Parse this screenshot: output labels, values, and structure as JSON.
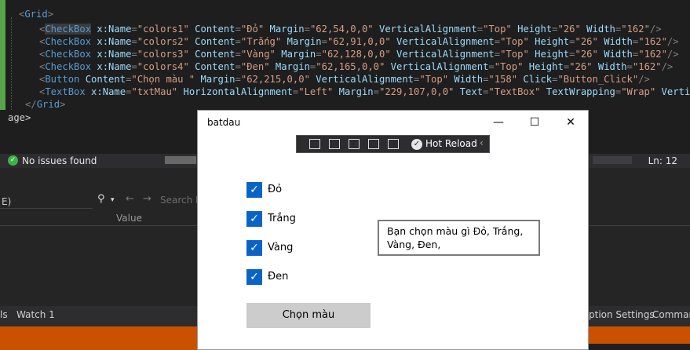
{
  "editor": {
    "lines": [
      [
        {
          "c": "tk-b",
          "t": "<"
        },
        {
          "c": "tk-t",
          "t": "Grid"
        },
        {
          "c": "tk-b",
          "t": ">"
        }
      ],
      [
        {
          "c": "tk-b",
          "t": "<"
        },
        {
          "c": "tk-t hl",
          "t": "CheckBox"
        },
        {
          "c": "tk-a",
          "t": " x:Name"
        },
        {
          "c": "tk-b",
          "t": "="
        },
        {
          "c": "tk-s",
          "t": "\"colors1\""
        },
        {
          "c": "tk-a",
          "t": " Content"
        },
        {
          "c": "tk-b",
          "t": "="
        },
        {
          "c": "tk-s",
          "t": "\"Đỏ\""
        },
        {
          "c": "tk-a",
          "t": " Margin"
        },
        {
          "c": "tk-b",
          "t": "="
        },
        {
          "c": "tk-s",
          "t": "\"62,54,0,0\""
        },
        {
          "c": "tk-a",
          "t": " VerticalAlignment"
        },
        {
          "c": "tk-b",
          "t": "="
        },
        {
          "c": "tk-s",
          "t": "\"Top\""
        },
        {
          "c": "tk-a",
          "t": " Height"
        },
        {
          "c": "tk-b",
          "t": "="
        },
        {
          "c": "tk-s",
          "t": "\"26\""
        },
        {
          "c": "tk-a",
          "t": " Width"
        },
        {
          "c": "tk-b",
          "t": "="
        },
        {
          "c": "tk-s",
          "t": "\"162\""
        },
        {
          "c": "tk-b",
          "t": "/>"
        }
      ],
      [
        {
          "c": "tk-b",
          "t": "<"
        },
        {
          "c": "tk-t",
          "t": "CheckBox"
        },
        {
          "c": "tk-a",
          "t": " x:Name"
        },
        {
          "c": "tk-b",
          "t": "="
        },
        {
          "c": "tk-s",
          "t": "\"colors2\""
        },
        {
          "c": "tk-a",
          "t": " Content"
        },
        {
          "c": "tk-b",
          "t": "="
        },
        {
          "c": "tk-s",
          "t": "\"Trắng\""
        },
        {
          "c": "tk-a",
          "t": " Margin"
        },
        {
          "c": "tk-b",
          "t": "="
        },
        {
          "c": "tk-s",
          "t": "\"62,91,0,0\""
        },
        {
          "c": "tk-a",
          "t": " VerticalAlignment"
        },
        {
          "c": "tk-b",
          "t": "="
        },
        {
          "c": "tk-s",
          "t": "\"Top\""
        },
        {
          "c": "tk-a",
          "t": " Height"
        },
        {
          "c": "tk-b",
          "t": "="
        },
        {
          "c": "tk-s",
          "t": "\"26\""
        },
        {
          "c": "tk-a",
          "t": " Width"
        },
        {
          "c": "tk-b",
          "t": "="
        },
        {
          "c": "tk-s",
          "t": "\"162\""
        },
        {
          "c": "tk-b",
          "t": "/>"
        }
      ],
      [
        {
          "c": "tk-b",
          "t": "<"
        },
        {
          "c": "tk-t",
          "t": "CheckBox"
        },
        {
          "c": "tk-a",
          "t": " x:Name"
        },
        {
          "c": "tk-b",
          "t": "="
        },
        {
          "c": "tk-s",
          "t": "\"colors3\""
        },
        {
          "c": "tk-a",
          "t": " Content"
        },
        {
          "c": "tk-b",
          "t": "="
        },
        {
          "c": "tk-s",
          "t": "\"Vàng\""
        },
        {
          "c": "tk-a",
          "t": " Margin"
        },
        {
          "c": "tk-b",
          "t": "="
        },
        {
          "c": "tk-s",
          "t": "\"62,128,0,0\""
        },
        {
          "c": "tk-a",
          "t": " VerticalAlignment"
        },
        {
          "c": "tk-b",
          "t": "="
        },
        {
          "c": "tk-s",
          "t": "\"Top\""
        },
        {
          "c": "tk-a",
          "t": " Height"
        },
        {
          "c": "tk-b",
          "t": "="
        },
        {
          "c": "tk-s",
          "t": "\"26\""
        },
        {
          "c": "tk-a",
          "t": " Width"
        },
        {
          "c": "tk-b",
          "t": "="
        },
        {
          "c": "tk-s",
          "t": "\"162\""
        },
        {
          "c": "tk-b",
          "t": "/>"
        }
      ],
      [
        {
          "c": "tk-b",
          "t": "<"
        },
        {
          "c": "tk-t",
          "t": "CheckBox"
        },
        {
          "c": "tk-a",
          "t": " x:Name"
        },
        {
          "c": "tk-b",
          "t": "="
        },
        {
          "c": "tk-s",
          "t": "\"colors4\""
        },
        {
          "c": "tk-a",
          "t": " Content"
        },
        {
          "c": "tk-b",
          "t": "="
        },
        {
          "c": "tk-s",
          "t": "\"Đen\""
        },
        {
          "c": "tk-a",
          "t": " Margin"
        },
        {
          "c": "tk-b",
          "t": "="
        },
        {
          "c": "tk-s",
          "t": "\"62,165,0,0\""
        },
        {
          "c": "tk-a",
          "t": " VerticalAlignment"
        },
        {
          "c": "tk-b",
          "t": "="
        },
        {
          "c": "tk-s",
          "t": "\"Top\""
        },
        {
          "c": "tk-a",
          "t": " Height"
        },
        {
          "c": "tk-b",
          "t": "="
        },
        {
          "c": "tk-s",
          "t": "\"26\""
        },
        {
          "c": "tk-a",
          "t": " Width"
        },
        {
          "c": "tk-b",
          "t": "="
        },
        {
          "c": "tk-s",
          "t": "\"162\""
        },
        {
          "c": "tk-b",
          "t": "/>"
        }
      ],
      [
        {
          "c": "tk-b",
          "t": "<"
        },
        {
          "c": "tk-t",
          "t": "Button"
        },
        {
          "c": "tk-a",
          "t": " Content"
        },
        {
          "c": "tk-b",
          "t": "="
        },
        {
          "c": "tk-s",
          "t": "\"Chọn màu \""
        },
        {
          "c": "tk-a",
          "t": " Margin"
        },
        {
          "c": "tk-b",
          "t": "="
        },
        {
          "c": "tk-s",
          "t": "\"62,215,0,0\""
        },
        {
          "c": "tk-a",
          "t": " VerticalAlignment"
        },
        {
          "c": "tk-b",
          "t": "="
        },
        {
          "c": "tk-s",
          "t": "\"Top\""
        },
        {
          "c": "tk-a",
          "t": " Width"
        },
        {
          "c": "tk-b",
          "t": "="
        },
        {
          "c": "tk-s",
          "t": "\"158\""
        },
        {
          "c": "tk-a",
          "t": " Click"
        },
        {
          "c": "tk-b",
          "t": "="
        },
        {
          "c": "tk-s",
          "t": "\"Button_Click\""
        },
        {
          "c": "tk-b",
          "t": "/>"
        }
      ],
      [
        {
          "c": "tk-b",
          "t": "<"
        },
        {
          "c": "tk-t",
          "t": "TextBox"
        },
        {
          "c": "tk-a",
          "t": " x:Name"
        },
        {
          "c": "tk-b",
          "t": "="
        },
        {
          "c": "tk-s",
          "t": "\"txtMau\""
        },
        {
          "c": "tk-a",
          "t": " HorizontalAlignment"
        },
        {
          "c": "tk-b",
          "t": "="
        },
        {
          "c": "tk-s",
          "t": "\"Left\""
        },
        {
          "c": "tk-a",
          "t": " Margin"
        },
        {
          "c": "tk-b",
          "t": "="
        },
        {
          "c": "tk-s",
          "t": "\"229,107,0,0\""
        },
        {
          "c": "tk-a",
          "t": " Text"
        },
        {
          "c": "tk-b",
          "t": "="
        },
        {
          "c": "tk-s",
          "t": "\"TextBox\""
        },
        {
          "c": "tk-a",
          "t": " TextWrapping"
        },
        {
          "c": "tk-b",
          "t": "="
        },
        {
          "c": "tk-s",
          "t": "\"Wrap\""
        },
        {
          "c": "tk-a",
          "t": " VerticalAli"
        }
      ],
      [
        {
          "c": "tk-b",
          "t": "</"
        },
        {
          "c": "tk-t",
          "t": "Grid"
        },
        {
          "c": "tk-b",
          "t": ">"
        }
      ],
      [
        {
          "c": "tk-p",
          "t": "age>"
        }
      ]
    ]
  },
  "status": {
    "issues": "No issues found",
    "line": "Ln: 12"
  },
  "watch": {
    "search_prefix": "E)",
    "search_placeholder": "Search D",
    "value_header": "Value"
  },
  "bottom_tabs": {
    "left_fragment": "ls",
    "watch": "Watch 1",
    "settings_fragment": "ption Settings",
    "command_fragment": "Comman"
  },
  "window": {
    "title": "batdau",
    "minimize": "—",
    "maximize": "☐",
    "close": "✕",
    "hot_reload": "Hot Reload",
    "checkboxes": [
      {
        "label": "Đỏ",
        "checked": true
      },
      {
        "label": "Trắng",
        "checked": true
      },
      {
        "label": "Vàng",
        "checked": true
      },
      {
        "label": "Đen",
        "checked": true
      }
    ],
    "textbox_value": "Bạn chọn màu gì Đỏ, Trắng, Vàng, Đen,",
    "button_label": "Chọn màu"
  }
}
